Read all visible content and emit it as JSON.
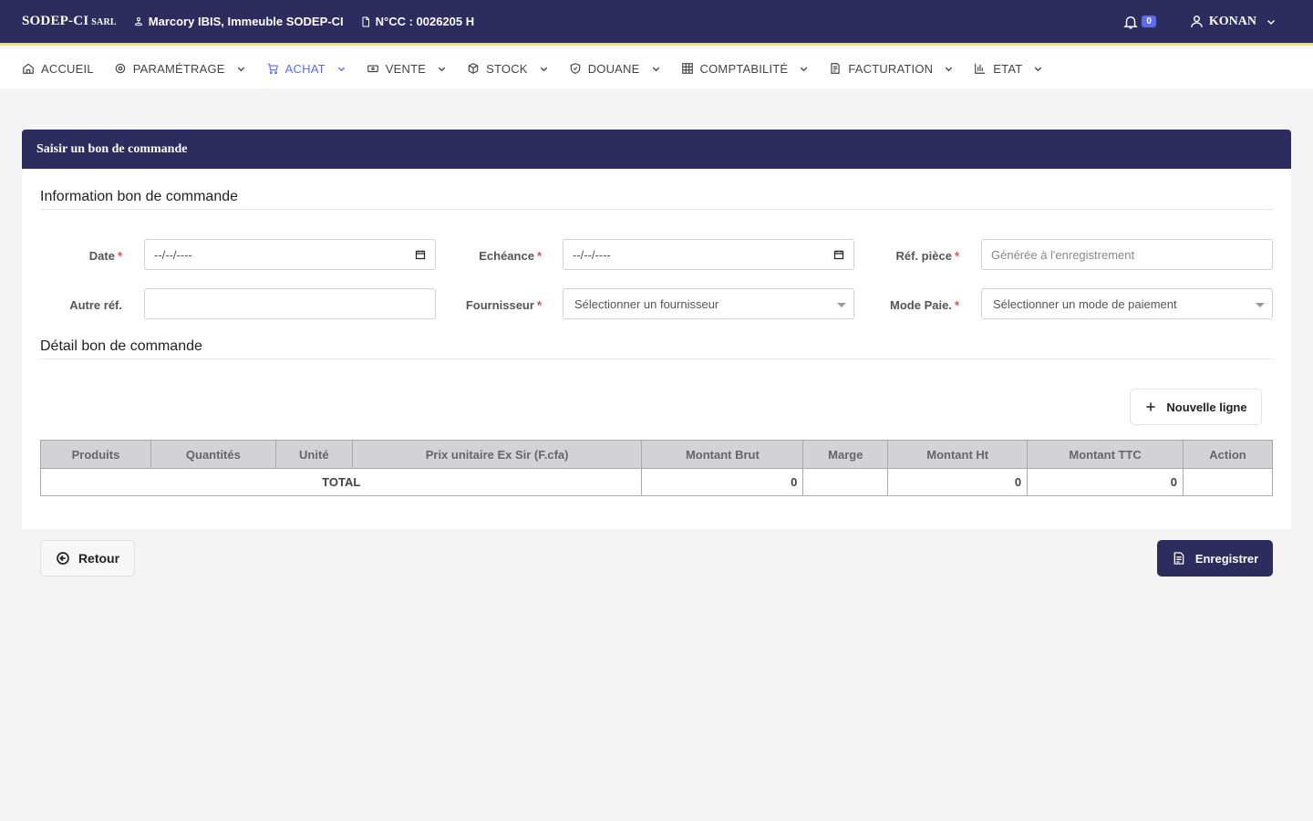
{
  "topbar": {
    "brand": "SODEP-CI",
    "brand_suffix": "SARL",
    "address": "Marcory IBIS, Immeuble SODEP-CI",
    "ncc": "N°CC : 0026205 H",
    "notif_count": "0",
    "user": "KONAN"
  },
  "nav": {
    "items": [
      {
        "label": "ACCUEIL"
      },
      {
        "label": "PARAMÉTRAGE"
      },
      {
        "label": "ACHAT"
      },
      {
        "label": "VENTE"
      },
      {
        "label": "STOCK"
      },
      {
        "label": "DOUANE"
      },
      {
        "label": "COMPTABILITÉ"
      },
      {
        "label": "FACTURATION"
      },
      {
        "label": "ETAT"
      }
    ],
    "active": "ACHAT"
  },
  "card": {
    "title": "Saisir un bon de commande",
    "section_info": "Information bon de commande",
    "section_detail": "Détail bon de commande"
  },
  "form": {
    "date_label": "Date",
    "date_value": "--/--/----",
    "echeance_label": "Echéance",
    "echeance_value": "--/--/----",
    "ref_piece_label": "Réf. pièce",
    "ref_piece_placeholder": "Générée à l'enregistrement",
    "autre_ref_label": "Autre réf.",
    "autre_ref_value": "",
    "fournisseur_label": "Fournisseur",
    "fournisseur_placeholder": "Sélectionner un fournisseur",
    "mode_paie_label": "Mode Paie.",
    "mode_paie_placeholder": "Sélectionner un mode de paiement",
    "required_mark": "*"
  },
  "table": {
    "add_line_label": "Nouvelle ligne",
    "headers": [
      "Produits",
      "Quantités",
      "Unité",
      "Prix unitaire Ex Sir (F.cfa)",
      "Montant Brut",
      "Marge",
      "Montant Ht",
      "Montant TTC",
      "Action"
    ],
    "total_label": "TOTAL",
    "total_brut": "0",
    "total_marge": "",
    "total_ht": "0",
    "total_ttc": "0"
  },
  "footer": {
    "back_label": "Retour",
    "save_label": "Enregistrer"
  },
  "colors": {
    "primary": "#2c2d5e",
    "accent": "#5b6cf0",
    "topbar_border": "#f2e84b"
  }
}
